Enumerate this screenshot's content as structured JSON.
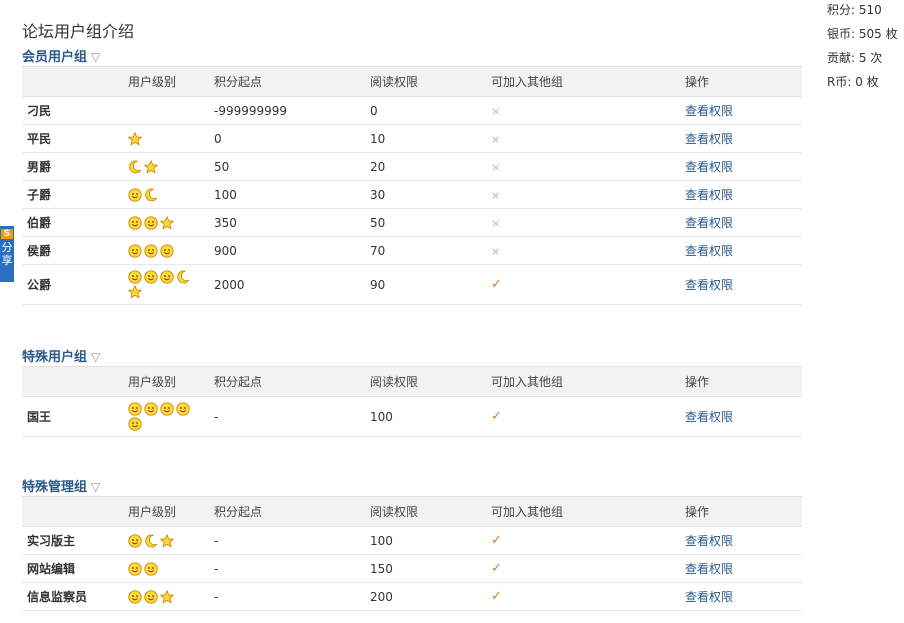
{
  "page_title": "论坛用户组介绍",
  "side_stats": [
    "积分: 510",
    "银币: 505 枚",
    "贡献: 5 次",
    "R币: 0 枚"
  ],
  "share_tab": {
    "logo": "S",
    "label": "分享"
  },
  "columns": [
    "用户级别",
    "积分起点",
    "阅读权限",
    "可加入其他组",
    "操作"
  ],
  "marks": {
    "yes": "✓",
    "no": "×"
  },
  "sections": [
    {
      "title": "会员用户组",
      "toggle": "▽",
      "rows": [
        {
          "name": "刁民",
          "icons": [],
          "points": "-999999999",
          "read": "0",
          "join": "no",
          "action": "查看权限"
        },
        {
          "name": "平民",
          "icons": [
            "star"
          ],
          "points": "0",
          "read": "10",
          "join": "no",
          "action": "查看权限"
        },
        {
          "name": "男爵",
          "icons": [
            "moon",
            "star"
          ],
          "points": "50",
          "read": "20",
          "join": "no",
          "action": "查看权限"
        },
        {
          "name": "子爵",
          "icons": [
            "sun",
            "moon"
          ],
          "points": "100",
          "read": "30",
          "join": "no",
          "action": "查看权限"
        },
        {
          "name": "伯爵",
          "icons": [
            "sun",
            "sun",
            "star"
          ],
          "points": "350",
          "read": "50",
          "join": "no",
          "action": "查看权限"
        },
        {
          "name": "侯爵",
          "icons": [
            "sun",
            "sun",
            "sun"
          ],
          "points": "900",
          "read": "70",
          "join": "no",
          "action": "查看权限"
        },
        {
          "name": "公爵",
          "icons": [
            "sun",
            "sun",
            "sun",
            "moon",
            "star"
          ],
          "points": "2000",
          "read": "90",
          "join": "yes",
          "action": "查看权限"
        }
      ]
    },
    {
      "title": "特殊用户组",
      "toggle": "▽",
      "rows": [
        {
          "name": "国王",
          "icons": [
            "sun",
            "sun",
            "sun",
            "sun",
            "sun"
          ],
          "points": "-",
          "read": "100",
          "join": "yes",
          "action": "查看权限"
        }
      ]
    },
    {
      "title": "特殊管理组",
      "toggle": "▽",
      "rows": [
        {
          "name": "实习版主",
          "icons": [
            "sun",
            "moon",
            "star"
          ],
          "points": "-",
          "read": "100",
          "join": "yes",
          "action": "查看权限"
        },
        {
          "name": "网站编辑",
          "icons": [
            "sun",
            "sun"
          ],
          "points": "-",
          "read": "150",
          "join": "yes",
          "action": "查看权限"
        },
        {
          "name": "信息监察员",
          "icons": [
            "sun",
            "sun",
            "star"
          ],
          "points": "-",
          "read": "200",
          "join": "yes",
          "action": "查看权限"
        }
      ]
    }
  ]
}
